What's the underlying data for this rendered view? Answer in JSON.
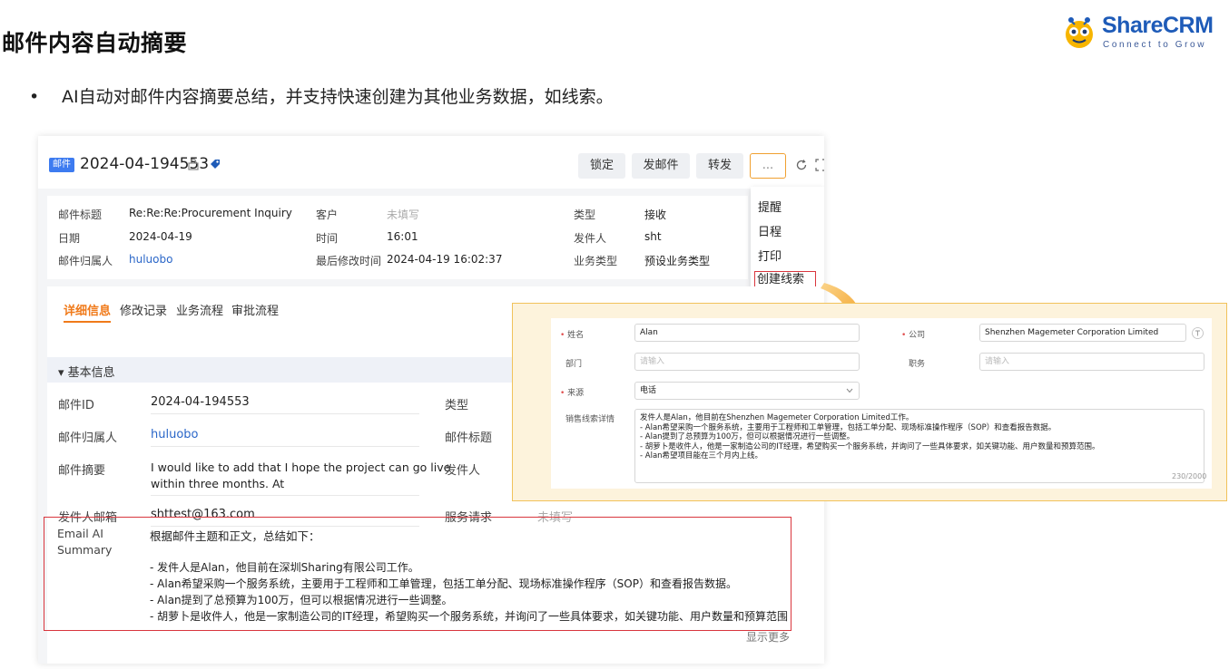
{
  "slide": {
    "title": "邮件内容自动摘要",
    "bullet_mark": "•",
    "bullet": "AI自动对邮件内容摘要总结，并支持快速创建为其他业务数据，如线索。"
  },
  "logo": {
    "name": "ShareCRM",
    "tagline": "Connect to Grow"
  },
  "header": {
    "badge": "邮件",
    "title": "2024-04-194553",
    "buttons": {
      "lock": "锁定",
      "send": "发邮件",
      "forward": "转发",
      "more": "..."
    }
  },
  "more_menu": {
    "items": [
      "提醒",
      "日程",
      "打印"
    ],
    "create_lead": "创建线索"
  },
  "info": {
    "subject_label": "邮件标题",
    "subject": "Re:Re:Re:Procurement Inquiry",
    "date_label": "日期",
    "date": "2024-04-19",
    "owner_label": "邮件归属人",
    "owner": "huluobo",
    "customer_label": "客户",
    "customer": "未填写",
    "time_label": "时间",
    "time": "16:01",
    "modified_label": "最后修改时间",
    "modified": "2024-04-19 16:02:37",
    "type_label": "类型",
    "type": "接收",
    "sender_label": "发件人",
    "sender": "sht",
    "biz_label": "业务类型",
    "biz": "预设业务类型"
  },
  "tabs": [
    "详细信息",
    "修改记录",
    "业务流程",
    "审批流程"
  ],
  "section_basic": "▾ 基本信息",
  "fields": {
    "id_label": "邮件ID",
    "id": "2024-04-194553",
    "owner_label": "邮件归属人",
    "owner": "huluobo",
    "summary_label": "邮件摘要",
    "summary_l1": "I would like to add that I hope the project can go live",
    "summary_l2": "within three months. At",
    "email_label": "发件人邮箱",
    "email": "shttest@163.com",
    "type_label": "类型",
    "subject_label": "邮件标题",
    "sender_label": "发件人",
    "service_label": "服务请求",
    "service": "未填写"
  },
  "ai_summary": {
    "label_l1": "Email AI",
    "label_l2": "Summary",
    "intro": "根据邮件主题和正文，总结如下：",
    "lines": [
      "- 发件人是Alan，他目前在深圳Sharing有限公司工作。",
      "- Alan希望采购一个服务系统，主要用于工程师和工单管理，包括工单分配、现场标准操作程序（SOP）和查看报告数据。",
      "- Alan提到了总预算为100万，但可以根据情况进行一些调整。",
      "- 胡萝卜是收件人，他是一家制造公司的IT经理，希望购买一个服务系统，并询问了一些具体要求，如关键功能、用户数量和预算范围..."
    ],
    "show_more": "显示更多"
  },
  "lead_form": {
    "name_label": "姓名",
    "name": "Alan",
    "company_label": "公司",
    "company": "Shenzhen Magemeter Corporation Limited",
    "dept_label": "部门",
    "dept_ph": "请输入",
    "title_label": "职务",
    "title_ph": "请输入",
    "source_label": "来源",
    "source": "电话",
    "detail_label": "销售线索详情",
    "detail_lines": [
      "发件人是Alan，他目前在Shenzhen Magemeter Corporation Limited工作。",
      "- Alan希望采购一个服务系统，主要用于工程师和工单管理，包括工单分配、现场标准操作程序（SOP）和查看报告数据。",
      "- Alan提到了总预算为100万，但可以根据情况进行一些调整。",
      "- 胡萝卜是收件人，他是一家制造公司的IT经理，希望购买一个服务系统，并询问了一些具体要求，如关键功能、用户数量和预算范围。",
      "- Alan希望项目能在三个月内上线。"
    ],
    "count": "230/2000"
  },
  "colors": {
    "accent": "#f07a1a",
    "highlight": "#d9363e",
    "brand": "#1e5bb8"
  }
}
